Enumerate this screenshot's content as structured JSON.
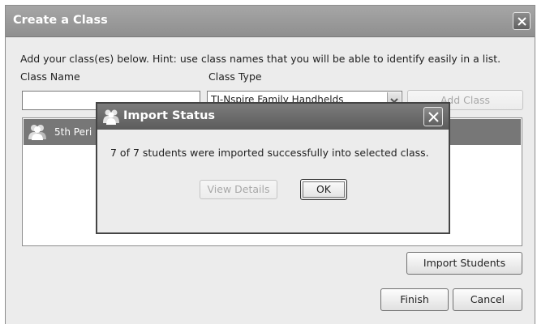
{
  "dialog": {
    "title": "Create a Class",
    "hint": "Add your class(es) below.  Hint: use class names that you will be able to identify easily in a list.",
    "class_name_label": "Class Name",
    "class_type_label": "Class Type",
    "class_name_value": "",
    "class_type_value": "TI-Nspire Family Handhelds",
    "add_class_label": "Add Class",
    "class_list": [
      {
        "name": "5th Peri",
        "icon": "class-group-icon"
      }
    ],
    "import_students_label": "Import Students",
    "finish_label": "Finish",
    "cancel_label": "Cancel",
    "close_icon": "close-icon"
  },
  "modal": {
    "title": "Import Status",
    "title_icon": "people-icon",
    "message": "7 of 7 students were imported successfully into selected class.",
    "view_details_label": "View Details",
    "ok_label": "OK",
    "close_icon": "close-icon"
  },
  "colors": {
    "titlebar": "#999999",
    "modal_titlebar": "#6b6b6b",
    "selected_row": "#777777"
  }
}
